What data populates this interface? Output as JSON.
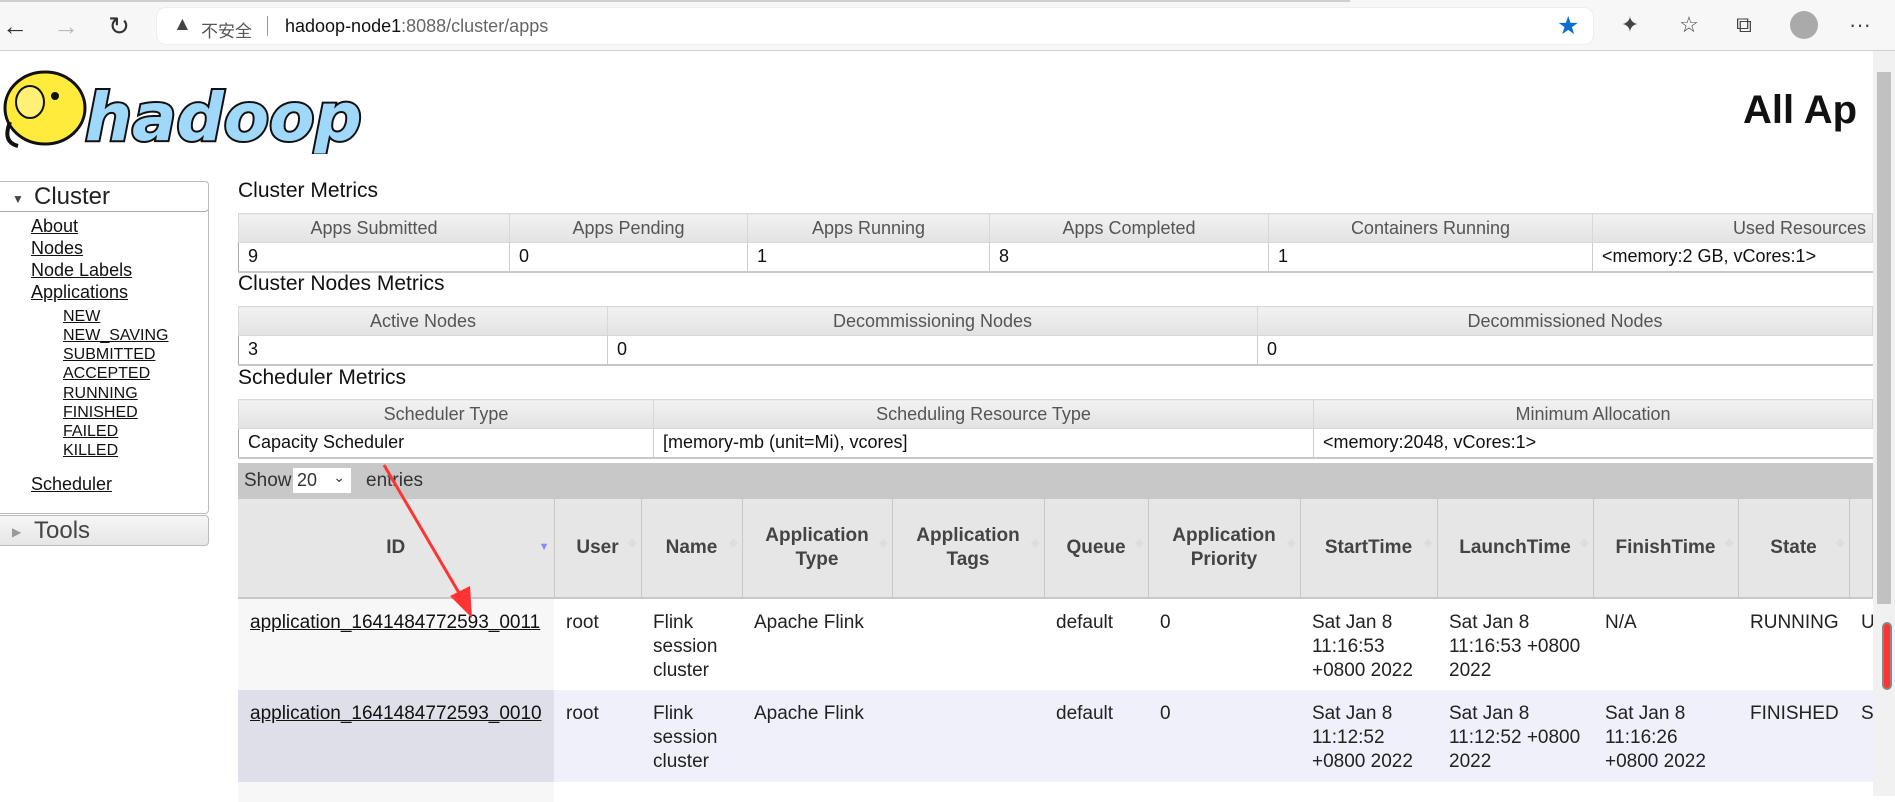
{
  "browser": {
    "back_icon": "←",
    "forward_icon": "→",
    "reload_icon": "↻",
    "warning_icon": "▲",
    "security_label": "不安全",
    "url_host": "hadoop-node1",
    "url_rest": ":8088/cluster/apps",
    "star_icon": "★",
    "extensions_icon": "✦",
    "favorites_icon": "☆",
    "collections_icon": "⧉",
    "more_icon": "···"
  },
  "header": {
    "logo_text": "hadoop",
    "title": "All Ap"
  },
  "sidebar": {
    "cluster_label": "Cluster",
    "tools_label": "Tools",
    "links": [
      "About",
      "Nodes",
      "Node Labels",
      "Applications"
    ],
    "states": [
      "NEW",
      "NEW_SAVING",
      "SUBMITTED",
      "ACCEPTED",
      "RUNNING",
      "FINISHED",
      "FAILED",
      "KILLED"
    ],
    "scheduler": "Scheduler"
  },
  "cluster_metrics": {
    "title": "Cluster Metrics",
    "headers": [
      "Apps Submitted",
      "Apps Pending",
      "Apps Running",
      "Apps Completed",
      "Containers Running",
      "Used Resources"
    ],
    "values": [
      "9",
      "0",
      "1",
      "8",
      "1",
      "<memory:2 GB, vCores:1>"
    ]
  },
  "nodes_metrics": {
    "title": "Cluster Nodes Metrics",
    "headers": [
      "Active Nodes",
      "Decommissioning Nodes",
      "Decommissioned Nodes"
    ],
    "values": [
      "3",
      "0",
      "0"
    ]
  },
  "scheduler_metrics": {
    "title": "Scheduler Metrics",
    "headers": [
      "Scheduler Type",
      "Scheduling Resource Type",
      "Minimum Allocation"
    ],
    "values": [
      "Capacity Scheduler",
      "[memory-mb (unit=Mi), vcores]",
      "<memory:2048, vCores:1>"
    ]
  },
  "apps_table": {
    "show_label": "Show",
    "entries_label": "entries",
    "page_size": "20",
    "headers": [
      "ID",
      "User",
      "Name",
      "Application Type",
      "Application Tags",
      "Queue",
      "Application Priority",
      "StartTime",
      "LaunchTime",
      "FinishTime",
      "State",
      ""
    ],
    "rows": [
      [
        "application_1641484772593_0011",
        "root",
        "Flink session cluster",
        "Apache Flink",
        "",
        "default",
        "0",
        "Sat Jan 8 11:16:53 +0800 2022",
        "Sat Jan 8 11:16:53 +0800 2022",
        "N/A",
        "RUNNING",
        "U"
      ],
      [
        "application_1641484772593_0010",
        "root",
        "Flink session cluster",
        "Apache Flink",
        "",
        "default",
        "0",
        "Sat Jan 8 11:12:52 +0800 2022",
        "Sat Jan 8 11:12:52 +0800 2022",
        "Sat Jan 8 11:16:26 +0800 2022",
        "FINISHED",
        "S"
      ]
    ]
  },
  "colors": {
    "annotation_arrow": "#ff3333",
    "star": "#0a6ed1",
    "show_bar": "#c8c8c8"
  }
}
